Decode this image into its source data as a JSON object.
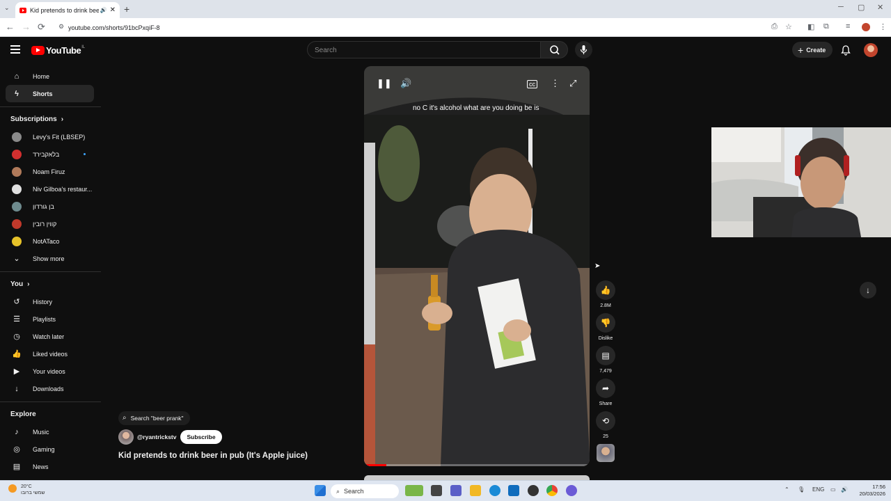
{
  "browser": {
    "tab_title": "Kid pretends to drink beer",
    "new_tab": "+",
    "tab_menu": "⌄",
    "tab_close": "✕",
    "url": "youtube.com/shorts/91bcPxqiF-8",
    "window_controls": [
      "─",
      "▢",
      "✕"
    ],
    "nav": {
      "back": "←",
      "forward": "→",
      "reload": "⟳"
    }
  },
  "masthead": {
    "logo_text": "YouTube",
    "country_code": "IL",
    "search_placeholder": "Search",
    "create_label": "Create"
  },
  "sidebar": {
    "main": [
      {
        "label": "Home",
        "icon": "home-icon",
        "glyph": "⌂"
      },
      {
        "label": "Shorts",
        "icon": "shorts-icon",
        "glyph": "ϟ",
        "active": true
      }
    ],
    "subscriptions_heading": "Subscriptions",
    "subscriptions": [
      {
        "label": "Levy's Fit (LBSEP)",
        "color": "#8a8a8a"
      },
      {
        "label": "בלאקבירד",
        "color": "#d32f2f",
        "new": true
      },
      {
        "label": "Noam Firuz",
        "color": "#b07a5a"
      },
      {
        "label": "Niv Gilboa's restaur...",
        "color": "#e0e0e0"
      },
      {
        "label": "בן גורדון",
        "color": "#6e8b8e"
      },
      {
        "label": "קווין רובין",
        "color": "#c0392b"
      },
      {
        "label": "NotATaco",
        "color": "#e6c229"
      }
    ],
    "show_more": "Show more",
    "you_heading": "You",
    "you": [
      {
        "label": "History",
        "icon": "history-icon",
        "glyph": "↺"
      },
      {
        "label": "Playlists",
        "icon": "playlists-icon",
        "glyph": "☰"
      },
      {
        "label": "Watch later",
        "icon": "watch-later-icon",
        "glyph": "◷"
      },
      {
        "label": "Liked videos",
        "icon": "like-icon",
        "glyph": "👍"
      },
      {
        "label": "Your videos",
        "icon": "your-videos-icon",
        "glyph": "▶"
      },
      {
        "label": "Downloads",
        "icon": "download-icon",
        "glyph": "↓"
      }
    ],
    "explore_heading": "Explore",
    "explore": [
      {
        "label": "Music",
        "icon": "music-icon",
        "glyph": "♪"
      },
      {
        "label": "Gaming",
        "icon": "gaming-icon",
        "glyph": "◎"
      },
      {
        "label": "News",
        "icon": "news-icon",
        "glyph": "▤"
      }
    ]
  },
  "short": {
    "caption": "no C it's alcohol what are you doing be is",
    "search_pill": "Search \"beer prank\"",
    "channel": "@ryantrickstv",
    "subscribe": "Subscribe",
    "title": "Kid pretends to drink beer in pub (It's Apple juice)",
    "progress": 0.1,
    "actions": {
      "likes": "2.8M",
      "dislike": "Dislike",
      "comments": "7,479",
      "share": "Share",
      "remix": "25"
    }
  },
  "taskbar": {
    "weather_temp": "20°C",
    "weather_desc": "שמשי ברובו",
    "search": "Search",
    "language": "ENG",
    "time": "17:56",
    "date": "20/03/2026"
  }
}
